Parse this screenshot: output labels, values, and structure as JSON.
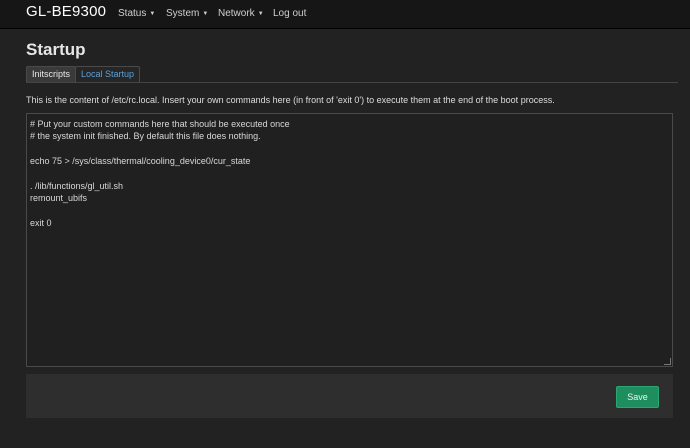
{
  "header": {
    "brand": "GL-BE9300",
    "nav": [
      {
        "label": "Status",
        "has_caret": true
      },
      {
        "label": "System",
        "has_caret": true
      },
      {
        "label": "Network",
        "has_caret": true
      },
      {
        "label": "Log out",
        "has_caret": false
      }
    ],
    "caret_icon": "caret-down-icon"
  },
  "page": {
    "title": "Startup",
    "tabs": [
      {
        "label": "Initscripts",
        "active": false
      },
      {
        "label": "Local Startup",
        "active": true
      }
    ],
    "description": "This is the content of /etc/rc.local. Insert your own commands here (in front of 'exit 0') to execute them at the end of the boot process.",
    "editor_lines": [
      "# Put your custom commands here that should be executed once",
      "# the system init finished. By default this file does nothing.",
      "",
      "echo 75 > /sys/class/thermal/cooling_device0/cur_state",
      "",
      ". /lib/functions/gl_util.sh",
      "remount_ubifs",
      "",
      "exit 0"
    ],
    "save_label": "Save"
  },
  "colors": {
    "background": "#222222",
    "navbar": "#161616",
    "active_tab_text": "#5aa0d8",
    "save_button": "#1e8e5e"
  }
}
